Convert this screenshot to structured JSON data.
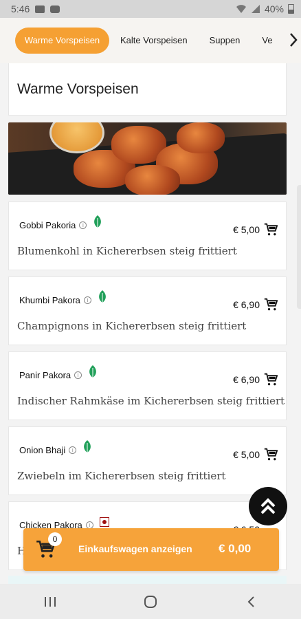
{
  "status_bar": {
    "time": "5:46",
    "battery": "40%"
  },
  "tabs": [
    {
      "label": "Warme Vorspeisen",
      "active": true
    },
    {
      "label": "Kalte Vorspeisen",
      "active": false
    },
    {
      "label": "Suppen",
      "active": false
    },
    {
      "label": "Ve",
      "active": false
    }
  ],
  "section": {
    "title": "Warme Vorspeisen"
  },
  "items": [
    {
      "name": "Gobbi Pakoria",
      "price": "€ 5,00",
      "description": "Blumenkohl in Kichererbsen steig frittiert",
      "type": "veg"
    },
    {
      "name": "Khumbi Pakora",
      "price": "€ 6,90",
      "description": "Champignons in Kichererbsen steig frittiert",
      "type": "veg"
    },
    {
      "name": "Panir Pakora",
      "price": "€ 6,90",
      "description": "Indischer Rahmkäse im Kichererbsen steig frittiert",
      "type": "veg"
    },
    {
      "name": "Onion Bhaji",
      "price": "€ 5,00",
      "description": "Zwiebeln im Kichererbsen steig frittiert",
      "type": "veg"
    },
    {
      "name": "Chicken Pakora",
      "price": "€ 6,50",
      "description": "H",
      "type": "non-veg"
    }
  ],
  "cart": {
    "count": "0",
    "label": "Einkaufswagen anzeigen",
    "total": "€ 0,00"
  },
  "colors": {
    "accent": "#f5a033",
    "veg": "#21a05a",
    "nonveg": "#a01010"
  },
  "icons": [
    "gallery-icon",
    "youtube-icon",
    "wifi-icon",
    "signal-icon",
    "battery-icon",
    "info-icon",
    "veg-leaf-icon",
    "add-to-cart-icon",
    "chevron-right-icon",
    "double-chevron-up-icon",
    "cart-icon",
    "recent-apps-icon",
    "home-icon",
    "back-icon"
  ]
}
